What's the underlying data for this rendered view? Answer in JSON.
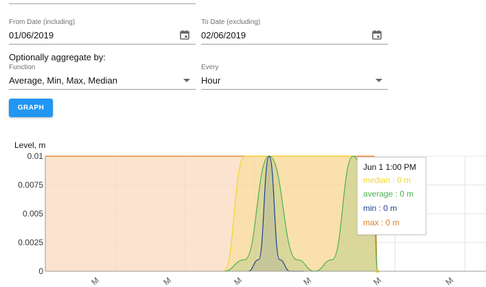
{
  "form": {
    "from_date": {
      "label": "From Date (including)",
      "value": "01/06/2019",
      "icon": "calendar-icon"
    },
    "to_date": {
      "label": "To Date (excluding)",
      "value": "02/06/2019",
      "icon": "calendar-icon"
    },
    "aggregate_title": "Optionally aggregate by:",
    "function": {
      "label": "Function",
      "value": "Average, Min, Max, Median",
      "icon": "dropdown-arrow-icon"
    },
    "every": {
      "label": "Every",
      "value": "Hour",
      "icon": "dropdown-arrow-icon"
    },
    "graph_button": "GRAPH"
  },
  "colors": {
    "button": "#2196f3",
    "median": "#f2d531",
    "average": "#4caf50",
    "min": "#1f3d8c",
    "max": "#e07b1f",
    "fill_max": "#fbd9bf"
  },
  "chart_data": {
    "type": "area",
    "ylabel": "Level, m",
    "y_ticks": [
      "0.01",
      "0.0075",
      "0.005",
      "0.0025",
      "0"
    ],
    "ylim": [
      0,
      0.01
    ],
    "x_tick_labels": [
      "M",
      "M",
      "M",
      "M",
      "M",
      "M"
    ],
    "grid": true,
    "series": [
      {
        "name": "max",
        "x": [
          0,
          3.5,
          3.6,
          3.9,
          4.2,
          4.5,
          4.7,
          4.75
        ],
        "y": [
          0.01,
          0.01,
          0.01,
          0.01,
          0.01,
          0.01,
          0.01,
          0
        ]
      },
      {
        "name": "median",
        "x": [
          2.55,
          2.85,
          3.3,
          3.7,
          4.05,
          4.4,
          4.7,
          4.75
        ],
        "y": [
          0,
          0.01,
          0.01,
          0.01,
          0.01,
          0.01,
          0.0045,
          0
        ]
      },
      {
        "name": "average",
        "x": [
          2.55,
          2.85,
          3.2,
          3.6,
          3.85,
          4.1,
          4.4,
          4.7,
          4.75
        ],
        "y": [
          0,
          0.001,
          0.01,
          0.001,
          0,
          0.001,
          0.01,
          0.0045,
          0
        ]
      },
      {
        "name": "min",
        "x": [
          2.9,
          3.05,
          3.2,
          3.35,
          3.5,
          3.7
        ],
        "y": [
          0,
          0.001,
          0.01,
          0.001,
          0,
          0
        ]
      }
    ],
    "tooltip": {
      "title": "Jun 1 1:00 PM",
      "rows": [
        {
          "label": "median : 0 m",
          "color": "#f2d531"
        },
        {
          "label": "average : 0 m",
          "color": "#4caf50"
        },
        {
          "label": "min : 0 m",
          "color": "#1f3d8c"
        },
        {
          "label": "max : 0 m",
          "color": "#e07b1f"
        }
      ]
    }
  }
}
